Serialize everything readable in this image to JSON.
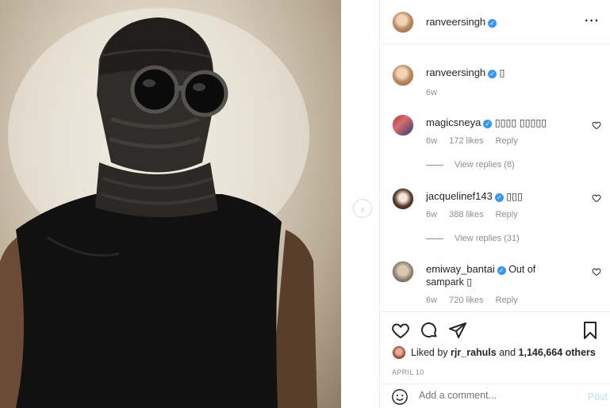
{
  "post": {
    "author": "ranveersingh",
    "more_icon": "more-options-icon"
  },
  "caption": {
    "author": "ranveersingh",
    "text": "▯",
    "time": "6w"
  },
  "comments": [
    {
      "author": "magicsneya",
      "text": "▯▯▯▯ ▯▯▯▯▯",
      "time": "6w",
      "likes": "172 likes",
      "reply": "Reply",
      "view_replies": "View replies (8)"
    },
    {
      "author": "jacquelinef143",
      "text": "▯▯▯",
      "time": "6w",
      "likes": "388 likes",
      "reply": "Reply",
      "view_replies": "View replies (31)"
    },
    {
      "author": "emiway_bantai",
      "text": "Out of sampark ▯",
      "time": "6w",
      "likes": "720 likes",
      "reply": "Reply"
    }
  ],
  "likes": {
    "prefix": "Liked by",
    "user": "rjr_rahuls",
    "and": "and",
    "others": "1,146,664 others"
  },
  "date": "APRIL 10",
  "add_comment": {
    "placeholder": "Add a comment...",
    "post_label": "Post"
  },
  "colors": {
    "verified": "#3897f0",
    "muted": "#8e8e8e",
    "post_disabled": "#b2dffc"
  }
}
